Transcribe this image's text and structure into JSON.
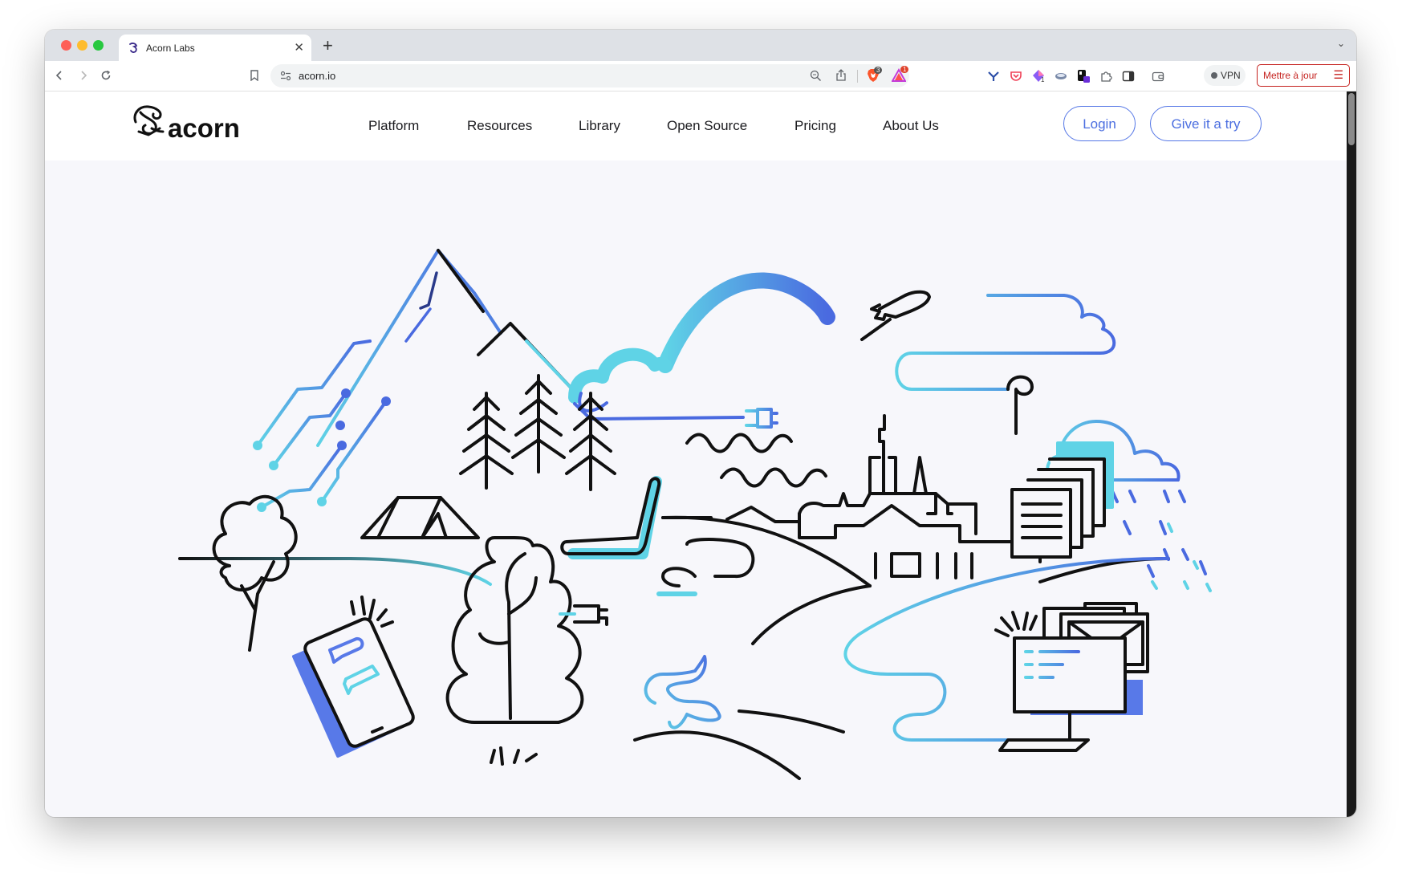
{
  "browser": {
    "tab_title": "Acorn Labs",
    "address": "acorn.io",
    "vpn_label": "VPN",
    "update_label": "Mettre à jour",
    "badge_brave": "3",
    "badge_alerts": "1",
    "badge_ext": "1"
  },
  "site": {
    "logo_text": "acorn",
    "nav": [
      "Platform",
      "Resources",
      "Library",
      "Open Source",
      "Pricing",
      "About Us"
    ],
    "login_label": "Login",
    "try_label": "Give it a try",
    "accent_color": "#4b6ee0",
    "cyan_color": "#5fd3e6"
  }
}
